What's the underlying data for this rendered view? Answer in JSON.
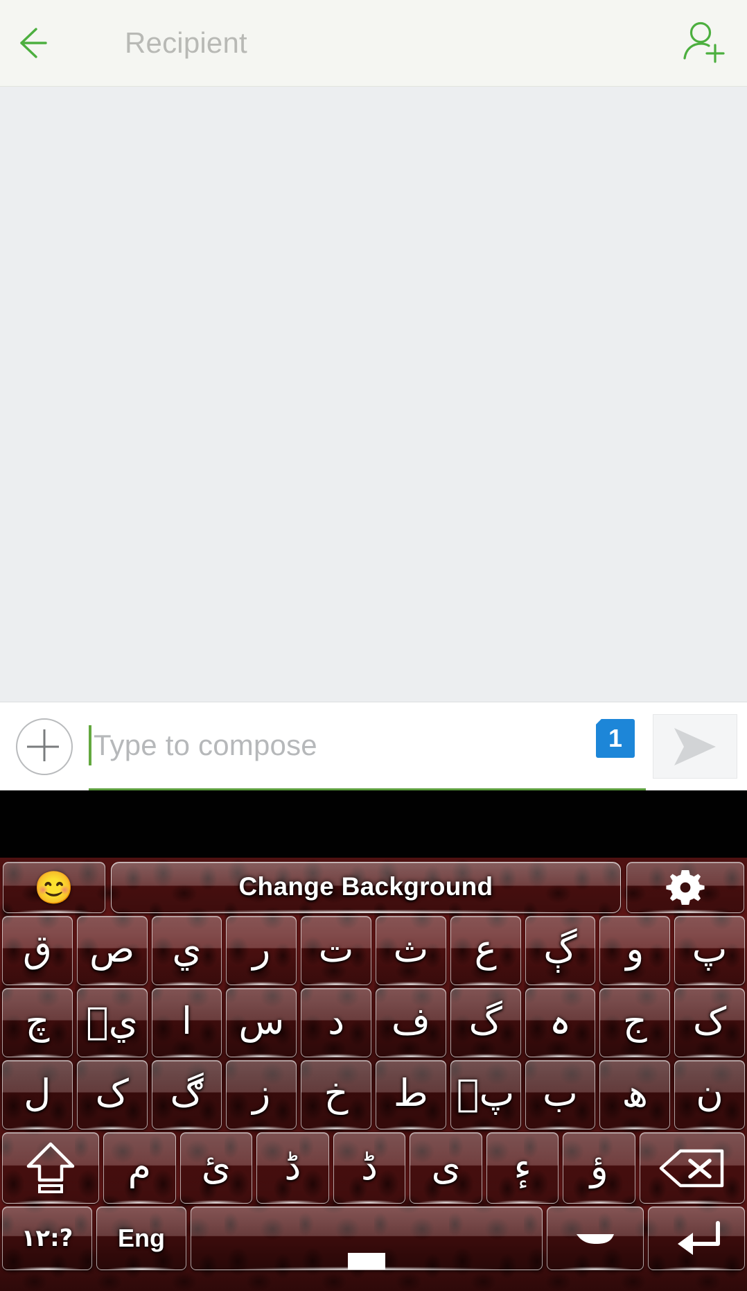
{
  "app": {
    "screen_name": "new-message-compose"
  },
  "appbar": {
    "back_icon": "back-arrow-icon",
    "recipient_placeholder": "Recipient",
    "recipient_value": "",
    "add_contact_icon": "add-person-icon",
    "accent_color": "#4caf3f",
    "background_color": "#f5f6f2"
  },
  "message_area": {
    "background_color": "#eceef0",
    "messages": []
  },
  "compose": {
    "attach_icon": "plus-circle-icon",
    "input_value": "",
    "input_placeholder": "Type to compose",
    "underline_color": "#5d9e3f",
    "sim_badge": "1",
    "sim_badge_color": "#1d86d8",
    "send_icon": "send-paper-plane-icon",
    "send_label": "Send"
  },
  "keyboard": {
    "theme_color": "#5c1414",
    "function_row": {
      "emoji_key": "emoji-smiling-face-icon",
      "emoji_glyph": "😊",
      "change_background_label": "Change Background",
      "settings_key": "gear-icon"
    },
    "rows": [
      {
        "name": "row-1",
        "keys": [
          {
            "glyph": "ق",
            "name": "key-qaf"
          },
          {
            "glyph": "ص",
            "name": "key-sad"
          },
          {
            "glyph": "ي",
            "name": "key-ye"
          },
          {
            "glyph": "ر",
            "name": "key-re"
          },
          {
            "glyph": "ت",
            "name": "key-te"
          },
          {
            "glyph": "ث",
            "name": "key-se"
          },
          {
            "glyph": "ع",
            "name": "key-ain"
          },
          {
            "glyph": "ڳ",
            "name": "key-gaf-dotted"
          },
          {
            "glyph": "و",
            "name": "key-vao"
          },
          {
            "glyph": "پ",
            "name": "key-pe"
          }
        ]
      },
      {
        "name": "row-2",
        "keys": [
          {
            "glyph": "چ",
            "name": "key-che"
          },
          {
            "glyph": "يٜ",
            "name": "key-ye-variant"
          },
          {
            "glyph": "ا",
            "name": "key-alif"
          },
          {
            "glyph": "س",
            "name": "key-sin"
          },
          {
            "glyph": "د",
            "name": "key-dal"
          },
          {
            "glyph": "ف",
            "name": "key-fe"
          },
          {
            "glyph": "گ",
            "name": "key-gaf"
          },
          {
            "glyph": "ہ",
            "name": "key-he-goal"
          },
          {
            "glyph": "ج",
            "name": "key-jim"
          },
          {
            "glyph": "ک",
            "name": "key-kaf"
          }
        ]
      },
      {
        "name": "row-3",
        "keys": [
          {
            "glyph": "ل",
            "name": "key-lam"
          },
          {
            "glyph": "ک",
            "name": "key-kaf-2"
          },
          {
            "glyph": "ڰ",
            "name": "key-gaf-ring"
          },
          {
            "glyph": "ز",
            "name": "key-ze"
          },
          {
            "glyph": "خ",
            "name": "key-khe"
          },
          {
            "glyph": "ط",
            "name": "key-toe"
          },
          {
            "glyph": "پٜ",
            "name": "key-pe-variant"
          },
          {
            "glyph": "ب",
            "name": "key-be"
          },
          {
            "glyph": "ھ",
            "name": "key-do-chashmi-he"
          },
          {
            "glyph": "ن",
            "name": "key-nun"
          }
        ]
      },
      {
        "name": "row-4",
        "keys": [
          {
            "glyph": "",
            "name": "key-shift",
            "icon": "shift-up-arrow-icon"
          },
          {
            "glyph": "م",
            "name": "key-mim"
          },
          {
            "glyph": "ئ",
            "name": "key-hamza-ye"
          },
          {
            "glyph": "ڈ",
            "name": "key-dal-retroflex"
          },
          {
            "glyph": "ڈ",
            "name": "key-dal-dotted"
          },
          {
            "glyph": "ى",
            "name": "key-alif-maqsura"
          },
          {
            "glyph": "ءٕ",
            "name": "key-hamza"
          },
          {
            "glyph": "ؤ",
            "name": "key-hamza-vao"
          },
          {
            "glyph": "",
            "name": "key-backspace",
            "icon": "backspace-icon"
          }
        ]
      },
      {
        "name": "row-5",
        "keys": [
          {
            "glyph": "۱۲:?",
            "name": "key-symbols",
            "label": "۱۲:?"
          },
          {
            "glyph": "Eng",
            "name": "key-language-toggle",
            "label": "Eng"
          },
          {
            "glyph": "",
            "name": "key-space",
            "label": ""
          },
          {
            "glyph": "",
            "name": "key-dash",
            "icon": "dash-icon"
          },
          {
            "glyph": "",
            "name": "key-enter",
            "icon": "enter-return-icon"
          }
        ]
      }
    ]
  }
}
